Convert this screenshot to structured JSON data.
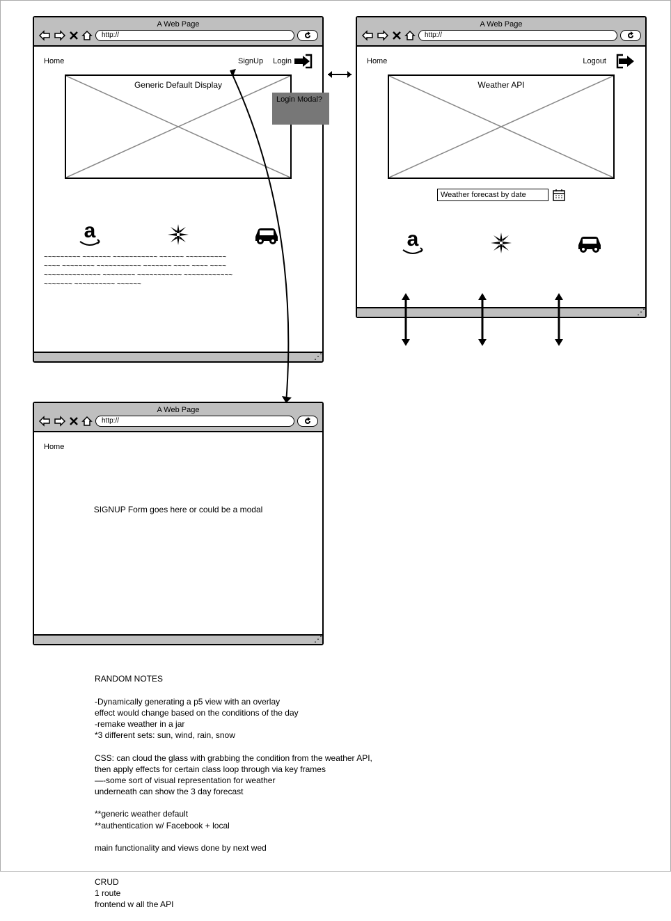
{
  "browsers": {
    "title": "A Web Page",
    "url": "http://",
    "home": "Home",
    "signup": "SignUp",
    "login": "Login",
    "logout": "Logout",
    "generic_display": "Generic Default Display",
    "weather_api": "Weather API",
    "forecast_placeholder": "Weather forecast by date",
    "signup_form": "SIGNUP Form goes here or could be a modal",
    "login_modal": "Login Modal?"
  },
  "notes": {
    "title": "RANDOM NOTES",
    "body": "-Dynamically generating a p5 view with an overlay\neffect would change based on the conditions of the day\n-remake weather in a jar\n*3 different sets: sun, wind, rain, snow\n\nCSS: can cloud the glass with grabbing the condition from the weather API,\nthen apply effects for certain class loop through via key frames\n—-some sort of visual representation for weather\n        underneath can show the 3 day forecast\n\n**generic weather default\n**authentication w/ Facebook + local\n\nmain functionality and views done by next wed\n\n\nCRUD\n1 route\nfrontend w all the API"
  },
  "squiggles": [
    "~~~~~~~~~ ~~~~~~~ ~~~~~~~~~~~ ~~~~~~ ~~~~~~~~~~",
    "~~~~ ~~~~~~~~ ~~~~~~~~~~~ ~~~~~~~ ~~~~ ~~~~ ~~~~",
    "~~~~~~~~~~~~~~ ~~~~~~~~ ~~~~~~~~~~~ ~~~~~~~~~~~~",
    "~~~~~~~ ~~~~~~~~~~ ~~~~~~"
  ]
}
